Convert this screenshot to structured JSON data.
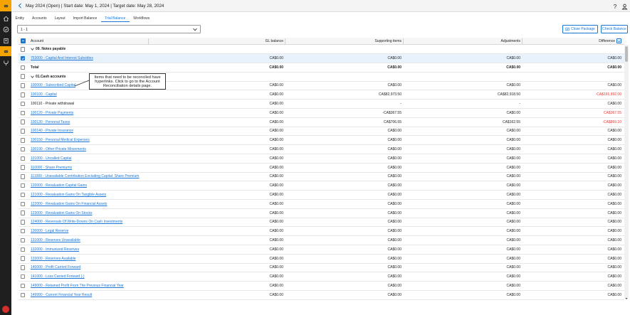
{
  "header": {
    "title": "May 2024 (Open) | Start date: May 1, 2024 | Target date: May 28, 2024",
    "help_icon": "help-icon",
    "user_icon": "user-account-icon"
  },
  "rail": {
    "icons": [
      "logo-infinity-icon",
      "home-icon",
      "check-circle-icon",
      "book-icon",
      "close-management-icon",
      "fork-icon"
    ]
  },
  "tabs": [
    {
      "label": "Entity",
      "active": false
    },
    {
      "label": "Accounts",
      "active": false
    },
    {
      "label": "Layout",
      "active": false
    },
    {
      "label": "Import Balance",
      "active": false
    },
    {
      "label": "Trial Balance",
      "active": true
    },
    {
      "label": "Workflows",
      "active": false
    }
  ],
  "period_select": {
    "value": "1 - 1"
  },
  "buttons": {
    "close_package": "Close Package",
    "check_balance": "Check Balance"
  },
  "columns": {
    "account": "Account",
    "gl_balance": "GL balance",
    "supporting_items": "Supporting items",
    "adjustments": "Adjustments",
    "difference": "Difference"
  },
  "callout": {
    "text": "Items that need to be reconciled have hyperlinks. Click to go to the Account Reconciliation details page."
  },
  "rows": [
    {
      "type": "group",
      "account": "09. Notes payable"
    },
    {
      "type": "account",
      "account": "753000 - Capital And Interest Subsidies",
      "link": true,
      "checked": true,
      "gl": "CA$0.00",
      "sup": "CA$0.00",
      "adj": "CA$0.00",
      "diff": "CA$0.00",
      "neg": false
    },
    {
      "type": "total",
      "account": "Total",
      "gl": "CA$0.00",
      "sup": "CA$0.00",
      "adj": "CA$0.00",
      "diff": "CA$0.00",
      "neg": false
    },
    {
      "type": "group",
      "account": "01.Cash accounts"
    },
    {
      "type": "account",
      "account": "100000 - Subscribed Capital",
      "link": true,
      "checked": false,
      "gl": "CA$0.00",
      "sup": "CA$0.00",
      "adj": "CA$0.00",
      "diff": "CA$0.00",
      "neg": false
    },
    {
      "type": "account",
      "account": "100100 - Capital",
      "link": true,
      "checked": false,
      "gl": "CA$0.00",
      "sup": "CA$82,973.50",
      "adj": "CA$82,918.50",
      "diff": "-CA$165,892.00",
      "neg": true
    },
    {
      "type": "account",
      "account": "100110 - Private withdrawal",
      "link": false,
      "checked": false,
      "gl": "CA$0.00",
      "sup": "-",
      "adj": "-",
      "diff": "CA$0.00",
      "neg": false
    },
    {
      "type": "account",
      "account": "100120 - Private Payments",
      "link": true,
      "checked": false,
      "gl": "CA$0.00",
      "sup": "-CA$367.55",
      "adj": "CA$0.00",
      "diff": "CA$367.55",
      "neg": true
    },
    {
      "type": "account",
      "account": "100130 - Personal Taxes",
      "link": true,
      "checked": false,
      "gl": "CA$0.00",
      "sup": "CA$706.55",
      "adj": "CA$162.55",
      "diff": "-CA$869.10",
      "neg": true
    },
    {
      "type": "account",
      "account": "100140 - Private Insurance",
      "link": true,
      "checked": false,
      "gl": "CA$0.00",
      "sup": "CA$0.00",
      "adj": "CA$0.00",
      "diff": "CA$0.00",
      "neg": false
    },
    {
      "type": "account",
      "account": "100150 - Personal Medical Expenses",
      "link": true,
      "checked": false,
      "gl": "CA$0.00",
      "sup": "CA$0.00",
      "adj": "CA$0.00",
      "diff": "CA$0.00",
      "neg": false
    },
    {
      "type": "account",
      "account": "100190 - Other Private Movements",
      "link": true,
      "checked": false,
      "gl": "CA$0.00",
      "sup": "CA$0.00",
      "adj": "CA$0.00",
      "diff": "CA$0.00",
      "neg": false
    },
    {
      "type": "account",
      "account": "101000 - Uncalled Capital",
      "link": true,
      "checked": false,
      "gl": "CA$0.00",
      "sup": "CA$0.00",
      "adj": "CA$0.00",
      "diff": "CA$0.00",
      "neg": false
    },
    {
      "type": "account",
      "account": "110000 - Share Premiums",
      "link": true,
      "checked": false,
      "gl": "CA$0.00",
      "sup": "CA$0.00",
      "adj": "CA$0.00",
      "diff": "CA$0.00",
      "neg": false
    },
    {
      "type": "account",
      "account": "111000 - Unavailable Contribution Excluding Capital: Share Premium",
      "link": true,
      "checked": false,
      "gl": "CA$0.00",
      "sup": "CA$0.00",
      "adj": "CA$0.00",
      "diff": "CA$0.00",
      "neg": false
    },
    {
      "type": "account",
      "account": "120000 - Revaluation Capital Gains",
      "link": true,
      "checked": false,
      "gl": "CA$0.00",
      "sup": "CA$0.00",
      "adj": "CA$0.00",
      "diff": "CA$0.00",
      "neg": false
    },
    {
      "type": "account",
      "account": "121000 - Revaluation Gains On Tangible Assets",
      "link": true,
      "checked": false,
      "gl": "CA$0.00",
      "sup": "CA$0.00",
      "adj": "CA$0.00",
      "diff": "CA$0.00",
      "neg": false
    },
    {
      "type": "account",
      "account": "122000 - Revaluation Gains On Financial Assets",
      "link": true,
      "checked": false,
      "gl": "CA$0.00",
      "sup": "CA$0.00",
      "adj": "CA$0.00",
      "diff": "CA$0.00",
      "neg": false
    },
    {
      "type": "account",
      "account": "123000 - Revaluation Gains On Stocks",
      "link": true,
      "checked": false,
      "gl": "CA$0.00",
      "sup": "CA$0.00",
      "adj": "CA$0.00",
      "diff": "CA$0.00",
      "neg": false
    },
    {
      "type": "account",
      "account": "124000 - Reversals Of Write-Downs On Cash Investments",
      "link": true,
      "checked": false,
      "gl": "CA$0.00",
      "sup": "CA$0.00",
      "adj": "CA$0.00",
      "diff": "CA$0.00",
      "neg": false
    },
    {
      "type": "account",
      "account": "130000 - Legal Reserve",
      "link": true,
      "checked": false,
      "gl": "CA$0.00",
      "sup": "CA$0.00",
      "adj": "CA$0.00",
      "diff": "CA$0.00",
      "neg": false
    },
    {
      "type": "account",
      "account": "131000 - Reserves Unavailable",
      "link": true,
      "checked": false,
      "gl": "CA$0.00",
      "sup": "CA$0.00",
      "adj": "CA$0.00",
      "diff": "CA$0.00",
      "neg": false
    },
    {
      "type": "account",
      "account": "132000 - Immunized Reserves",
      "link": true,
      "checked": false,
      "gl": "CA$0.00",
      "sup": "CA$0.00",
      "adj": "CA$0.00",
      "diff": "CA$0.00",
      "neg": false
    },
    {
      "type": "account",
      "account": "133000 - Reserves Available",
      "link": true,
      "checked": false,
      "gl": "CA$0.00",
      "sup": "CA$0.00",
      "adj": "CA$0.00",
      "diff": "CA$0.00",
      "neg": false
    },
    {
      "type": "account",
      "account": "140000 - Profit Carried Forward",
      "link": true,
      "checked": false,
      "gl": "CA$0.00",
      "sup": "CA$0.00",
      "adj": "CA$0.00",
      "diff": "CA$0.00",
      "neg": false
    },
    {
      "type": "account",
      "account": "141000 - Loss Carried Forward (-)",
      "link": true,
      "checked": false,
      "gl": "CA$0.00",
      "sup": "CA$0.00",
      "adj": "CA$0.00",
      "diff": "CA$0.00",
      "neg": false
    },
    {
      "type": "account",
      "account": "149000 - Retained Profit From The Previous Financial Year",
      "link": true,
      "checked": false,
      "gl": "CA$0.00",
      "sup": "CA$0.00",
      "adj": "CA$0.00",
      "diff": "CA$0.00",
      "neg": false
    },
    {
      "type": "account",
      "account": "149990 - Current Financial Year Result",
      "link": true,
      "checked": false,
      "gl": "CA$0.00",
      "sup": "CA$0.00",
      "adj": "CA$0.00",
      "diff": "CA$0.00",
      "neg": false
    }
  ],
  "colors": {
    "accent": "#1976d2",
    "rail": "#1f1f1f",
    "rail_active": "#f5a300",
    "negative": "#e53935"
  }
}
